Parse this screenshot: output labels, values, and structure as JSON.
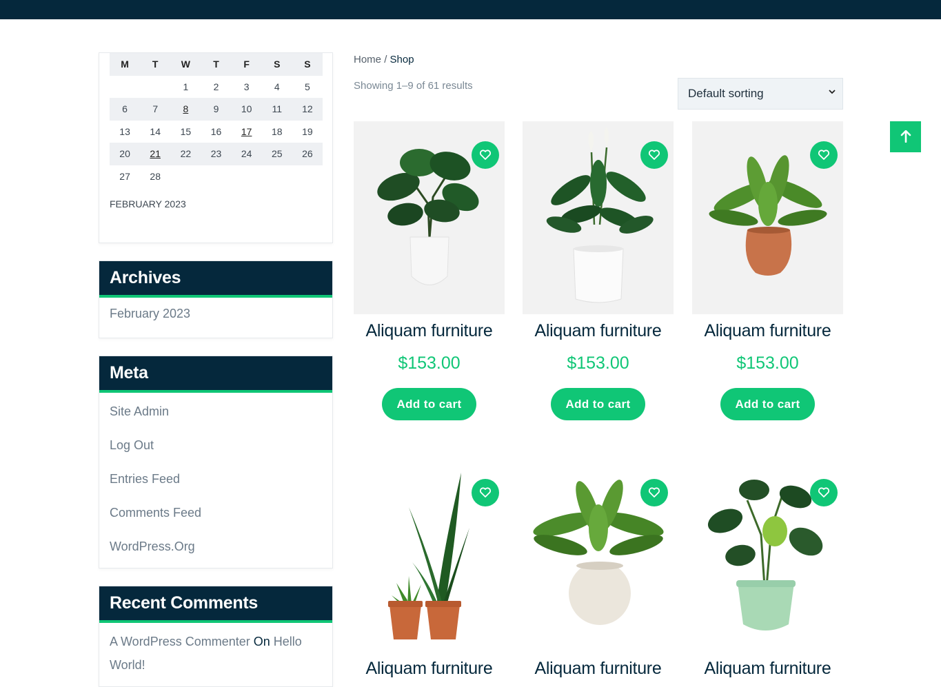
{
  "calendar": {
    "weekdays": [
      "M",
      "T",
      "W",
      "T",
      "F",
      "S",
      "S"
    ],
    "weeks": [
      [
        "",
        "",
        "1",
        "2",
        "3",
        "4",
        "5"
      ],
      [
        "6",
        "7",
        "8",
        "9",
        "10",
        "11",
        "12"
      ],
      [
        "13",
        "14",
        "15",
        "16",
        "17",
        "18",
        "19"
      ],
      [
        "20",
        "21",
        "22",
        "23",
        "24",
        "25",
        "26"
      ],
      [
        "27",
        "28",
        "",
        "",
        "",
        "",
        ""
      ]
    ],
    "linked_days": [
      "8",
      "17",
      "21"
    ],
    "caption": "FEBRUARY 2023"
  },
  "archives": {
    "title": "Archives",
    "items": [
      "February 2023"
    ]
  },
  "meta": {
    "title": "Meta",
    "items": [
      "Site Admin",
      "Log Out",
      "Entries Feed",
      "Comments Feed",
      "WordPress.Org"
    ]
  },
  "recent_comments": {
    "title": "Recent Comments",
    "author": "A WordPress Commenter",
    "on": "On",
    "post": "Hello World!"
  },
  "breadcrumb": {
    "home": "Home",
    "separator": "/",
    "current": "Shop"
  },
  "result_count": "Showing 1–9 of 61 results",
  "sorting": {
    "selected": "Default sorting"
  },
  "scroll_top_icon": "arrow-up-icon",
  "products": [
    {
      "title": "Aliquam furniture",
      "price": "$153.00",
      "cart_label": "Add to cart",
      "image": "monstera-white-pot"
    },
    {
      "title": "Aliquam furniture",
      "price": "$153.00",
      "cart_label": "Add to cart",
      "image": "peace-lily-white-pot"
    },
    {
      "title": "Aliquam furniture",
      "price": "$153.00",
      "cart_label": "Add to cart",
      "image": "birds-nest-fern-terracotta-pot"
    },
    {
      "title": "Aliquam furniture",
      "image": "snake-plant-terracotta-pots"
    },
    {
      "title": "Aliquam furniture",
      "image": "birds-nest-fern-cream-pot"
    },
    {
      "title": "Aliquam furniture",
      "image": "monstera-mint-pot"
    }
  ],
  "colors": {
    "brand_dark": "#05283c",
    "accent_green": "#10c676"
  }
}
